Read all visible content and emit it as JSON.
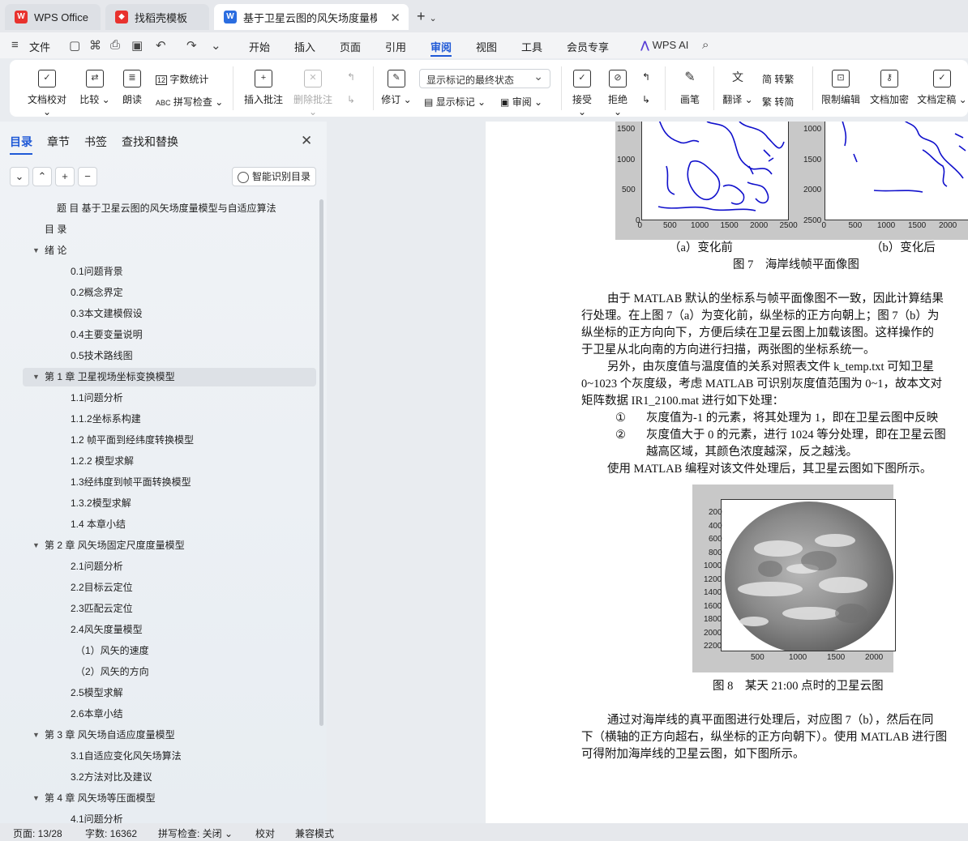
{
  "tabs": [
    {
      "label": "WPS Office"
    },
    {
      "label": "找稻壳模板"
    },
    {
      "label": "基于卫星云图的风矢场度量模型"
    }
  ],
  "menu": {
    "file": "文件",
    "items": [
      "开始",
      "插入",
      "页面",
      "引用",
      "审阅",
      "视图",
      "工具",
      "会员专享"
    ],
    "active": "审阅",
    "ai": "WPS AI"
  },
  "ribbon": {
    "proof": "文档校对",
    "compare": "比较",
    "read": "朗读",
    "wordcount": "字数统计",
    "spell": "拼写检查",
    "insert_comment": "插入批注",
    "delete_comment": "删除批注",
    "revise": "修订",
    "markstate": "显示标记的最终状态",
    "show_marks": "显示标记",
    "review": "审阅",
    "accept": "接受",
    "reject": "拒绝",
    "pen": "画笔",
    "translate": "翻译",
    "t2s": "转繁",
    "s2t": "转简",
    "restrict": "限制编辑",
    "encrypt": "文档加密",
    "finalize": "文档定稿"
  },
  "sidebar": {
    "tabs": [
      "目录",
      "章节",
      "书签",
      "查找和替换"
    ],
    "smart": "智能识别目录",
    "toc": [
      "题 目 基于卫星云图的风矢场度量模型与自适应算法",
      "目 录",
      "绪 论",
      "0.1问题背景",
      "0.2概念界定",
      "0.3本文建模假设",
      "0.4主要变量说明",
      "0.5技术路线图",
      "第 1 章 卫星视场坐标变换模型",
      "1.1问题分析",
      "1.1.2坐标系构建",
      "1.2 帧平面到经纬度转换模型",
      "1.2.2 模型求解",
      "1.3经纬度到帧平面转换模型",
      "1.3.2模型求解",
      "1.4 本章小结",
      "第 2 章 风矢场固定尺度度量模型",
      "2.1问题分析",
      "2.2目标云定位",
      "2.3匹配云定位",
      "2.4风矢度量模型",
      "（1）风矢的速度",
      "（2）风矢的方向",
      "2.5模型求解",
      "2.6本章小结",
      "第 3 章 风矢场自适应度量模型",
      "3.1自适应变化风矢场算法",
      "3.2方法对比及建议",
      "第 4 章 风矢场等压面模型",
      "4.1问题分析"
    ]
  },
  "doc": {
    "fig7_left_y": [
      "1500",
      "1000",
      "500",
      "0"
    ],
    "fig7_left_x": [
      "0",
      "500",
      "1000",
      "1500",
      "2000",
      "2500"
    ],
    "fig7_right_y": [
      "1000",
      "1500",
      "2000",
      "2500"
    ],
    "fig7_right_x": [
      "0",
      "500",
      "1000",
      "1500",
      "2000"
    ],
    "sub_a": "（a）变化前",
    "sub_b": "（b）变化后",
    "cap7": "图 7　海岸线帧平面像图",
    "p1": [
      "由于 MATLAB 默认的坐标系与帧平面像图不一致，因此计算结果",
      "行处理。在上图 7（a）为变化前，纵坐标的正方向朝上；图 7（b）为",
      "纵坐标的正方向向下，方便后续在卫星云图上加载该图。这样操作的",
      "于卫星从北向南的方向进行扫描，两张图的坐标系统一。"
    ],
    "p2": [
      "另外，由灰度值与温度值的关系对照表文件 k_temp.txt 可知卫星",
      "0~1023 个灰度级，考虑 MATLAB 可识别灰度值范围为 0~1，故本文对",
      "矩阵数据 IR1_2100.mat 进行如下处理："
    ],
    "li1_num": "①",
    "li1": "灰度值为-1 的元素，将其处理为 1，即在卫星云图中反映",
    "li2_num": "②",
    "li2": "灰度值大于 0 的元素，进行 1024 等分处理，即在卫星云图",
    "li2b": "越高区域，其颜色浓度越深，反之越浅。",
    "p3": "使用 MATLAB 编程对该文件处理后，其卫星云图如下图所示。",
    "fig8_y": [
      "200",
      "400",
      "600",
      "800",
      "1000",
      "1200",
      "1400",
      "1600",
      "1800",
      "2000",
      "2200"
    ],
    "fig8_x": [
      "500",
      "1000",
      "1500",
      "2000"
    ],
    "cap8": "图 8　某天 21:00 点时的卫星云图",
    "p4": [
      "通过对海岸线的真平面图进行处理后，对应图 7（b），然后在同",
      "下（横轴的正方向超右，纵坐标的正方向朝下）。使用 MATLAB 进行图",
      "可得附加海岸线的卫星云图，如下图所示。"
    ]
  },
  "status": {
    "page": "页面: 13/28",
    "words": "字数: 16362",
    "spell": "拼写检查: 关闭",
    "proof": "校对",
    "compat": "兼容模式"
  },
  "colors": {
    "accent": "#1f59d6",
    "coast": "#1010cc"
  }
}
